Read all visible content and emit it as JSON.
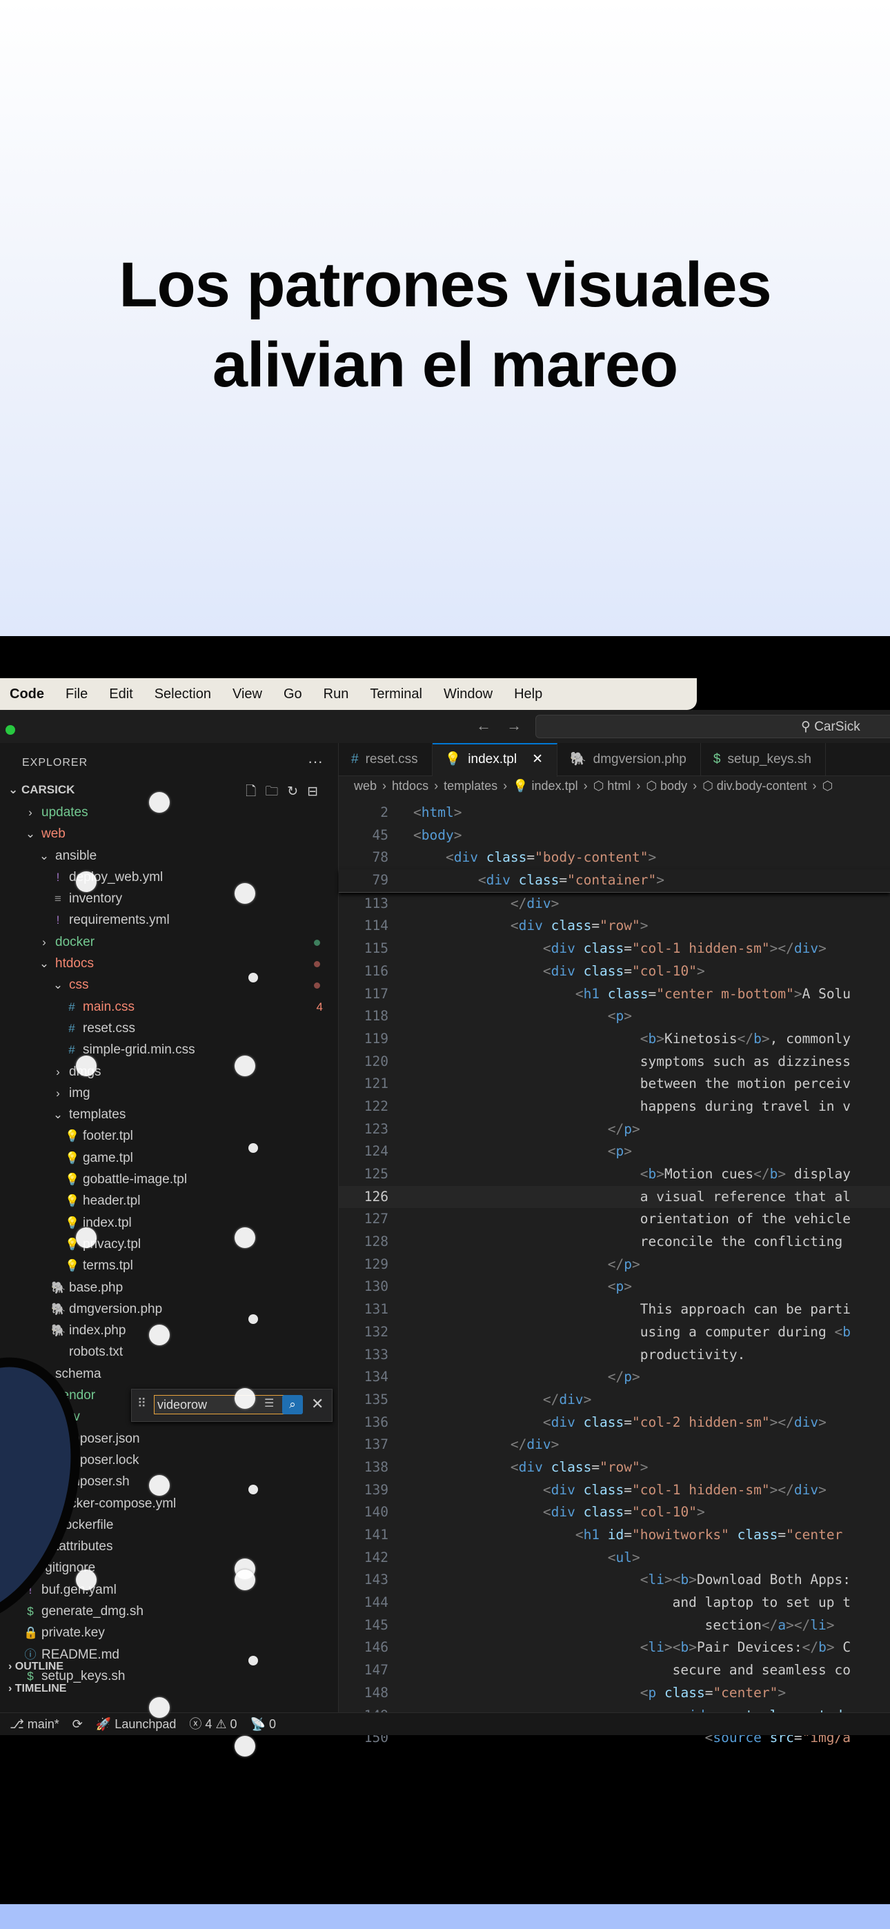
{
  "hero": {
    "title_line1": "Los patrones visuales",
    "title_line2": "alivian el mareo"
  },
  "menubar": {
    "app": "Code",
    "items": [
      "File",
      "Edit",
      "Selection",
      "View",
      "Go",
      "Run",
      "Terminal",
      "Window",
      "Help"
    ]
  },
  "titlebar": {
    "back": "←",
    "forward": "→",
    "command_center": "⚲ CarSick"
  },
  "sidebar": {
    "header": "EXPLORER",
    "more": "···",
    "root": "CARSICK",
    "find": {
      "value": "videorow"
    },
    "tree": [
      {
        "label": "updates",
        "depth": 1,
        "arrow": "›",
        "icon": "",
        "color": "green"
      },
      {
        "label": "web",
        "depth": 1,
        "arrow": "⌄",
        "icon": "",
        "color": "red"
      },
      {
        "label": "ansible",
        "depth": 2,
        "arrow": "⌄",
        "icon": "",
        "color": "white"
      },
      {
        "label": "deploy_web.yml",
        "depth": 3,
        "arrow": "",
        "icon": "!",
        "icon_color": "purple",
        "color": "white"
      },
      {
        "label": "inventory",
        "depth": 3,
        "arrow": "",
        "icon": "≡",
        "icon_color": "gray",
        "color": "white"
      },
      {
        "label": "requirements.yml",
        "depth": 3,
        "arrow": "",
        "icon": "!",
        "icon_color": "purple",
        "color": "white"
      },
      {
        "label": "docker",
        "depth": 2,
        "arrow": "›",
        "icon": "",
        "color": "green",
        "dot": "#3e7f5d"
      },
      {
        "label": "htdocs",
        "depth": 2,
        "arrow": "⌄",
        "icon": "",
        "color": "red",
        "dot": "#8a4a45"
      },
      {
        "label": "css",
        "depth": 3,
        "arrow": "⌄",
        "icon": "",
        "color": "red",
        "dot": "#8a4a45"
      },
      {
        "label": "main.css",
        "depth": 4,
        "arrow": "",
        "icon": "#",
        "icon_color": "blue",
        "color": "red",
        "badge": "4"
      },
      {
        "label": "reset.css",
        "depth": 4,
        "arrow": "",
        "icon": "#",
        "icon_color": "blue",
        "color": "white"
      },
      {
        "label": "simple-grid.min.css",
        "depth": 4,
        "arrow": "",
        "icon": "#",
        "icon_color": "blue",
        "color": "white"
      },
      {
        "label": "dmgs",
        "depth": 3,
        "arrow": "›",
        "icon": "",
        "color": "white"
      },
      {
        "label": "img",
        "depth": 3,
        "arrow": "›",
        "icon": "",
        "color": "white"
      },
      {
        "label": "templates",
        "depth": 3,
        "arrow": "⌄",
        "icon": "",
        "color": "white"
      },
      {
        "label": "footer.tpl",
        "depth": 4,
        "arrow": "",
        "icon": "💡",
        "icon_color": "yellow",
        "color": "white"
      },
      {
        "label": "game.tpl",
        "depth": 4,
        "arrow": "",
        "icon": "💡",
        "icon_color": "yellow",
        "color": "white"
      },
      {
        "label": "gobattle-image.tpl",
        "depth": 4,
        "arrow": "",
        "icon": "💡",
        "icon_color": "yellow",
        "color": "white"
      },
      {
        "label": "header.tpl",
        "depth": 4,
        "arrow": "",
        "icon": "💡",
        "icon_color": "yellow",
        "color": "white"
      },
      {
        "label": "index.tpl",
        "depth": 4,
        "arrow": "",
        "icon": "💡",
        "icon_color": "yellow",
        "color": "white"
      },
      {
        "label": "privacy.tpl",
        "depth": 4,
        "arrow": "",
        "icon": "💡",
        "icon_color": "yellow",
        "color": "white"
      },
      {
        "label": "terms.tpl",
        "depth": 4,
        "arrow": "",
        "icon": "💡",
        "icon_color": "yellow",
        "color": "white"
      },
      {
        "label": "base.php",
        "depth": 3,
        "arrow": "",
        "icon": "🐘",
        "icon_color": "purple",
        "color": "white"
      },
      {
        "label": "dmgversion.php",
        "depth": 3,
        "arrow": "",
        "icon": "🐘",
        "icon_color": "purple",
        "color": "white"
      },
      {
        "label": "index.php",
        "depth": 3,
        "arrow": "",
        "icon": "🐘",
        "icon_color": "purple",
        "color": "white"
      },
      {
        "label": "robots.txt",
        "depth": 3,
        "arrow": "",
        "icon": "",
        "icon_color": "gray",
        "color": "white"
      },
      {
        "label": "schema",
        "depth": 2,
        "arrow": "",
        "icon": "",
        "color": "white"
      },
      {
        "label": "vendor",
        "depth": 2,
        "arrow": "",
        "icon": "",
        "color": "green",
        "dot": "#3e7f5d"
      },
      {
        "label": ".env",
        "depth": 2,
        "arrow": "",
        "icon": "",
        "color": "green",
        "badge": "U"
      },
      {
        "label": "composer.json",
        "depth": 2,
        "arrow": "",
        "icon": "",
        "color": "white"
      },
      {
        "label": "composer.lock",
        "depth": 2,
        "arrow": "",
        "icon": "",
        "color": "white"
      },
      {
        "label": "composer.sh",
        "depth": 2,
        "arrow": "",
        "icon": "$",
        "icon_color": "green",
        "color": "white"
      },
      {
        "label": "docker-compose.yml",
        "depth": 2,
        "arrow": "",
        "icon": "🐳",
        "icon_color": "dock",
        "color": "white"
      },
      {
        "label": "Dockerfile",
        "depth": 2,
        "arrow": "",
        "icon": "🐳",
        "icon_color": "dock",
        "color": "white"
      },
      {
        "label": ".gitattributes",
        "depth": 1,
        "arrow": "",
        "icon": "◆",
        "icon_color": "gray",
        "color": "white"
      },
      {
        "label": ".gitignore",
        "depth": 1,
        "arrow": "",
        "icon": "◆",
        "icon_color": "gray",
        "color": "white"
      },
      {
        "label": "buf.gen.yaml",
        "depth": 1,
        "arrow": "",
        "icon": "!",
        "icon_color": "purple",
        "color": "white"
      },
      {
        "label": "generate_dmg.sh",
        "depth": 1,
        "arrow": "",
        "icon": "$",
        "icon_color": "green",
        "color": "white"
      },
      {
        "label": "private.key",
        "depth": 1,
        "arrow": "",
        "icon": "🔒",
        "icon_color": "yellow",
        "color": "white"
      },
      {
        "label": "README.md",
        "depth": 1,
        "arrow": "",
        "icon": "ⓘ",
        "icon_color": "blue",
        "color": "white"
      },
      {
        "label": "setup_keys.sh",
        "depth": 1,
        "arrow": "",
        "icon": "$",
        "icon_color": "green",
        "color": "white"
      }
    ],
    "outline": "OUTLINE",
    "timeline": "TIMELINE"
  },
  "editor": {
    "tabs": [
      {
        "icon": "#",
        "icon_color": "#519aba",
        "label": "reset.css",
        "active": false
      },
      {
        "icon": "💡",
        "icon_color": "#e8c24a",
        "label": "index.tpl",
        "active": true,
        "close": "✕"
      },
      {
        "icon": "🐘",
        "icon_color": "#a074c4",
        "label": "dmgversion.php",
        "active": false
      },
      {
        "icon": "$",
        "icon_color": "#73c991",
        "label": "setup_keys.sh",
        "active": false
      }
    ],
    "breadcrumbs": [
      "web",
      "›",
      "htdocs",
      "›",
      "templates",
      "›",
      "💡 index.tpl",
      "›",
      "⬡ html",
      "›",
      "⬡ body",
      "›",
      "⬡ div.body-content",
      "›",
      "⬡"
    ],
    "lines": [
      {
        "n": "2",
        "code": "<html>"
      },
      {
        "n": "45",
        "code": "<body>"
      },
      {
        "n": "78",
        "code": "    <div class=\"body-content\">"
      },
      {
        "n": "79",
        "code": "        <div class=\"container\">"
      },
      {
        "n": "113",
        "code": "            </div>"
      },
      {
        "n": "114",
        "code": "            <div class=\"row\">"
      },
      {
        "n": "115",
        "code": "                <div class=\"col-1 hidden-sm\"></div>"
      },
      {
        "n": "116",
        "code": "                <div class=\"col-10\">"
      },
      {
        "n": "117",
        "code": "                    <h1 class=\"center m-bottom\">A Solu"
      },
      {
        "n": "118",
        "code": "                        <p>"
      },
      {
        "n": "119",
        "code": "                            <b>Kinetosis</b>, commonly"
      },
      {
        "n": "120",
        "code": "                            symptoms such as dizziness"
      },
      {
        "n": "121",
        "code": "                            between the motion perceiv"
      },
      {
        "n": "122",
        "code": "                            happens during travel in v"
      },
      {
        "n": "123",
        "code": "                        </p>"
      },
      {
        "n": "124",
        "code": "                        <p>"
      },
      {
        "n": "125",
        "code": "                            <b>Motion cues</b> display"
      },
      {
        "n": "126",
        "code": "                            a visual reference that al"
      },
      {
        "n": "127",
        "code": "                            orientation of the vehicle"
      },
      {
        "n": "128",
        "code": "                            reconcile the conflicting "
      },
      {
        "n": "129",
        "code": "                        </p>"
      },
      {
        "n": "130",
        "code": "                        <p>"
      },
      {
        "n": "131",
        "code": "                            This approach can be parti"
      },
      {
        "n": "132",
        "code": "                            using a computer during <b"
      },
      {
        "n": "133",
        "code": "                            productivity."
      },
      {
        "n": "134",
        "code": "                        </p>"
      },
      {
        "n": "135",
        "code": "                </div>"
      },
      {
        "n": "136",
        "code": "                <div class=\"col-2 hidden-sm\"></div>"
      },
      {
        "n": "137",
        "code": "            </div>"
      },
      {
        "n": "138",
        "code": "            <div class=\"row\">"
      },
      {
        "n": "139",
        "code": "                <div class=\"col-1 hidden-sm\"></div>"
      },
      {
        "n": "140",
        "code": "                <div class=\"col-10\">"
      },
      {
        "n": "141",
        "code": "                    <h1 id=\"howitworks\" class=\"center "
      },
      {
        "n": "142",
        "code": "                        <ul>"
      },
      {
        "n": "143",
        "code": "                            <li><b>Download Both Apps:"
      },
      {
        "n": "144",
        "code": "                                and laptop to set up t"
      },
      {
        "n": "145",
        "code": "                                    section</a></li>"
      },
      {
        "n": "146",
        "code": "                            <li><b>Pair Devices:</b> C"
      },
      {
        "n": "147",
        "code": "                                secure and seamless co"
      },
      {
        "n": "148",
        "code": "                            <p class=\"center\">"
      },
      {
        "n": "149",
        "code": "                                <video autoplay muted "
      },
      {
        "n": "150",
        "code": "                                    <source src=\"img/a"
      }
    ],
    "current_line": "126"
  },
  "statusbar": {
    "branch": "⎇ main*",
    "sync": "⟳",
    "launchpad": "🚀 Launchpad",
    "problems": "ⓧ 4 ⚠ 0",
    "ports": "📡 0"
  },
  "colors": {
    "accent": "#0078d4",
    "editor_bg": "#1f1f1f",
    "sidebar_bg": "#181818",
    "hero_title": "#050505"
  }
}
